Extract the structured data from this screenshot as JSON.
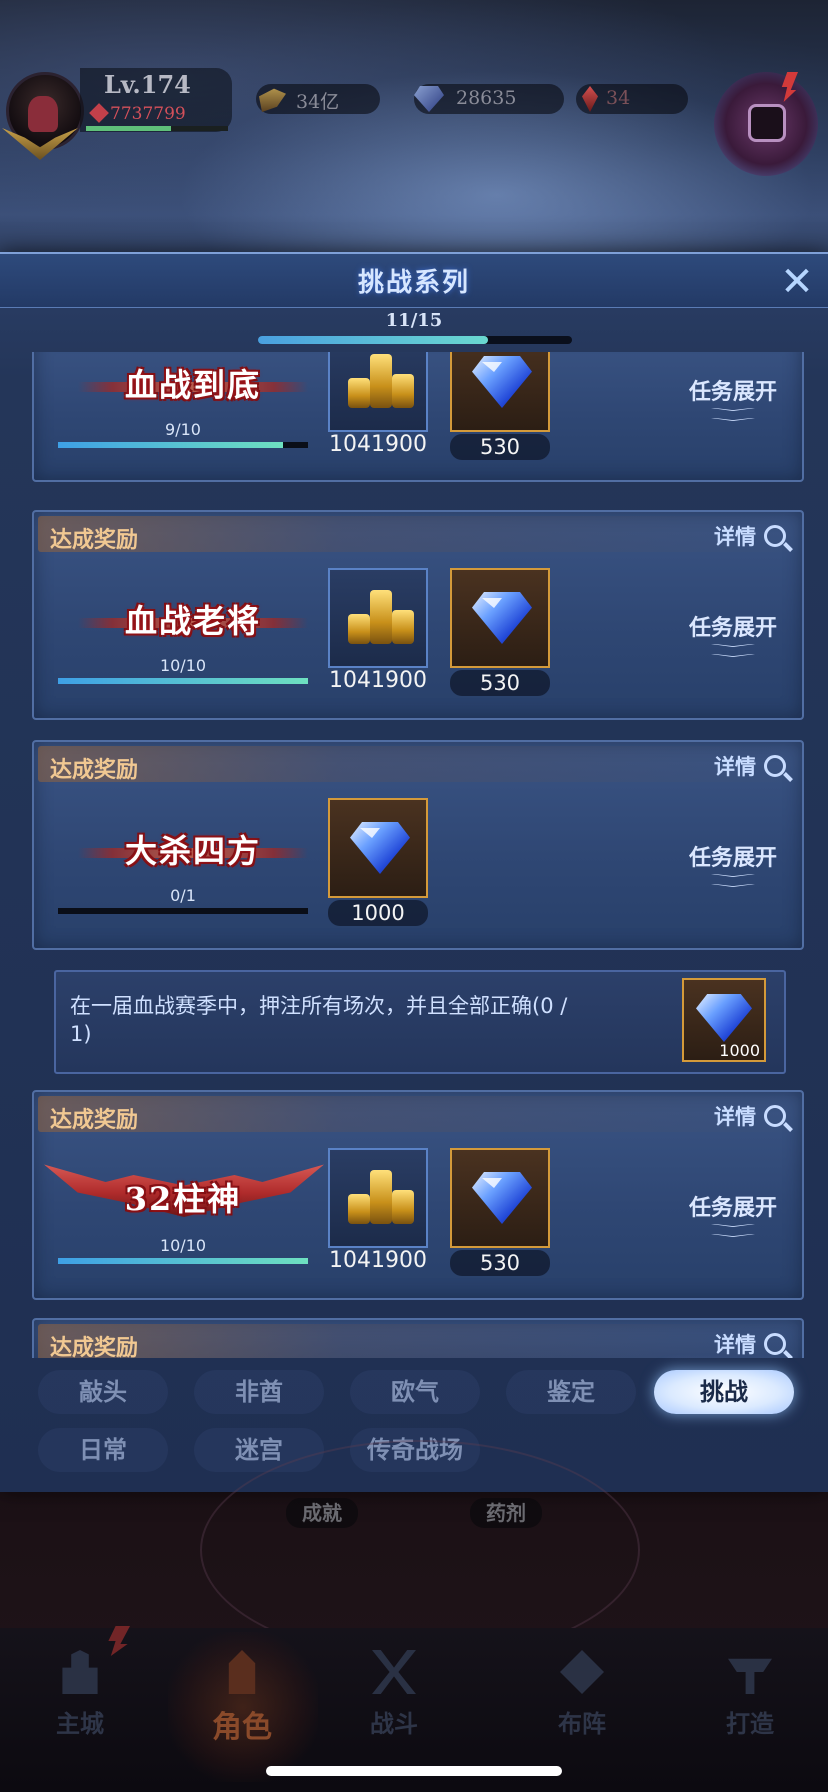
{
  "player": {
    "level": "Lv.174",
    "power": "7737799",
    "exp_progress": 0.6
  },
  "resources": {
    "gold": "34亿",
    "gems": "28635",
    "crystals": "34"
  },
  "modal": {
    "title": "挑战系列",
    "close": "✕",
    "progress_label": "11/15",
    "progress": 0.733
  },
  "cards": [
    {
      "header": "",
      "title": "血战到底",
      "progress_label": "9/10",
      "progress": 0.9,
      "expand_label": "任务展开",
      "rewards": [
        {
          "type": "gold",
          "count": "1041900"
        },
        {
          "type": "gem",
          "count": "530"
        }
      ]
    },
    {
      "header": "达成奖励",
      "detail": "详情",
      "title": "血战老将",
      "progress_label": "10/10",
      "progress": 1.0,
      "expand_label": "任务展开",
      "rewards": [
        {
          "type": "gold",
          "count": "1041900"
        },
        {
          "type": "gem",
          "count": "530"
        }
      ]
    },
    {
      "header": "达成奖励",
      "detail": "详情",
      "title": "大杀四方",
      "progress_label": "0/1",
      "progress": 0.0,
      "expand_label": "任务展开",
      "rewards": [
        {
          "type": "gem",
          "count": "1000"
        }
      ],
      "subtask": {
        "text": "在一届血战赛季中，押注所有场次，并且全部正确(0 / 1)",
        "reward_count": "1000"
      }
    },
    {
      "header": "达成奖励",
      "detail": "详情",
      "title": "32柱神",
      "progress_label": "10/10",
      "progress": 1.0,
      "expand_label": "任务展开",
      "rewards": [
        {
          "type": "gold",
          "count": "1041900"
        },
        {
          "type": "gem",
          "count": "530"
        }
      ]
    },
    {
      "header": "达成奖励",
      "detail": "详情"
    }
  ],
  "tabs": {
    "row1": [
      "敲头",
      "非酋",
      "欧气",
      "鉴定",
      "挑战"
    ],
    "row2": [
      "日常",
      "迷宫",
      "传奇战场"
    ],
    "active": "挑战"
  },
  "lower_labels": [
    "成就",
    "药剂"
  ],
  "nav": [
    "主城",
    "角色",
    "战斗",
    "布阵",
    "打造"
  ],
  "nav_active": "角色",
  "colors": {
    "accent_blue": "#6ad8d0",
    "gold_frame": "#d49a3a",
    "header_gold": "#f1c892",
    "title_red": "#b51c22"
  }
}
